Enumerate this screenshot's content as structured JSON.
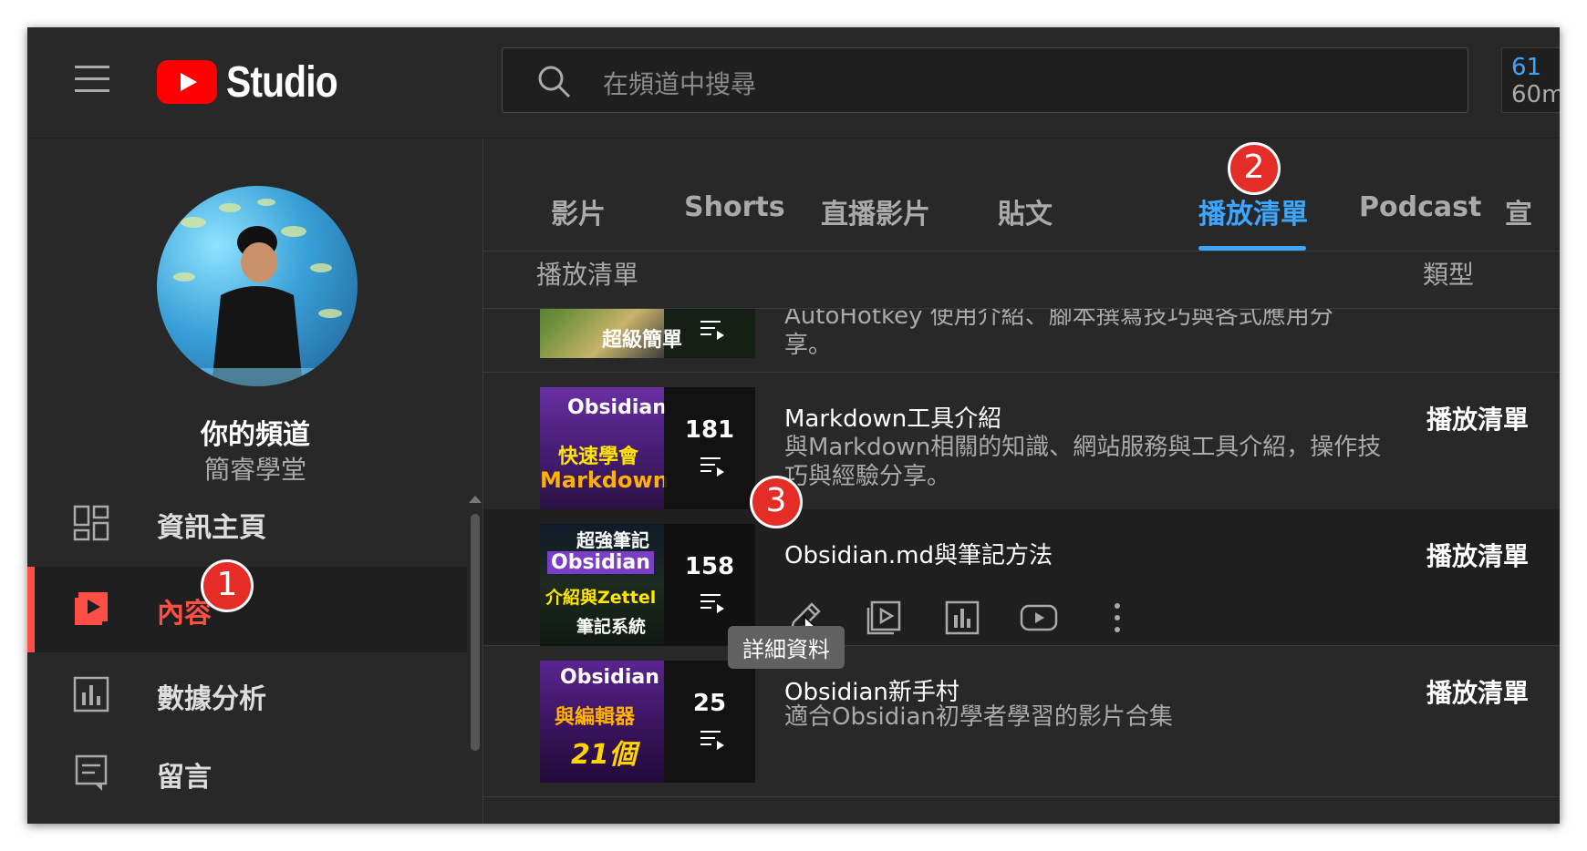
{
  "app": {
    "logo_text": "Studio",
    "search_placeholder": "在頻道中搜尋",
    "corner_line1": "61",
    "corner_line2": "60m"
  },
  "sidebar": {
    "channel_title": "你的頻道",
    "channel_name": "簡睿學堂",
    "items": [
      {
        "label": "資訊主頁",
        "active": false
      },
      {
        "label": "內容",
        "active": true
      },
      {
        "label": "數據分析",
        "active": false
      },
      {
        "label": "留言",
        "active": false
      }
    ]
  },
  "tabs": [
    {
      "label": "影片",
      "active": false
    },
    {
      "label": "Shorts",
      "active": false
    },
    {
      "label": "直播影片",
      "active": false
    },
    {
      "label": "貼文",
      "active": false
    },
    {
      "label": "播放清單",
      "active": true
    },
    {
      "label": "Podcast",
      "active": false
    },
    {
      "label": "宣",
      "active": false
    }
  ],
  "table": {
    "col_playlist": "播放清單",
    "col_type": "類型",
    "rows": [
      {
        "thumb_text": "超級簡單",
        "title": "",
        "desc_line1": "AutoHotkey 使用介紹、腳本撰寫技巧與各式應用分",
        "desc_line2": "享。",
        "count": "",
        "type": ""
      },
      {
        "thumb_text_a": "Obsidian",
        "thumb_text_b": "快速學會",
        "thumb_text_c": "Markdown",
        "title": "Markdown工具介紹",
        "desc": "與Markdown相關的知識、網站服務與工具介紹，操作技巧與經驗分享。",
        "count": "181",
        "type": "播放清單"
      },
      {
        "thumb_text_a": "超強筆記",
        "thumb_text_b": "Obsidian",
        "thumb_text_c": "介紹與Zettel",
        "thumb_text_d": "筆記系統",
        "title": "Obsidian.md與筆記方法",
        "count": "158",
        "type": "播放清單"
      },
      {
        "thumb_text_a": "Obsidian",
        "thumb_text_b": "與編輯器",
        "thumb_text_c": "21個",
        "title": "Obsidian新手村",
        "desc": "適合Obsidian初學者學習的影片合集",
        "count": "25",
        "type": "播放清單"
      }
    ]
  },
  "tooltip": "詳細資料",
  "badges": [
    "1",
    "2",
    "3"
  ],
  "colors": {
    "accent_blue": "#3ea6ff",
    "active_red": "#ff4e45",
    "badge_red": "#e52d27",
    "bg": "#282828"
  }
}
